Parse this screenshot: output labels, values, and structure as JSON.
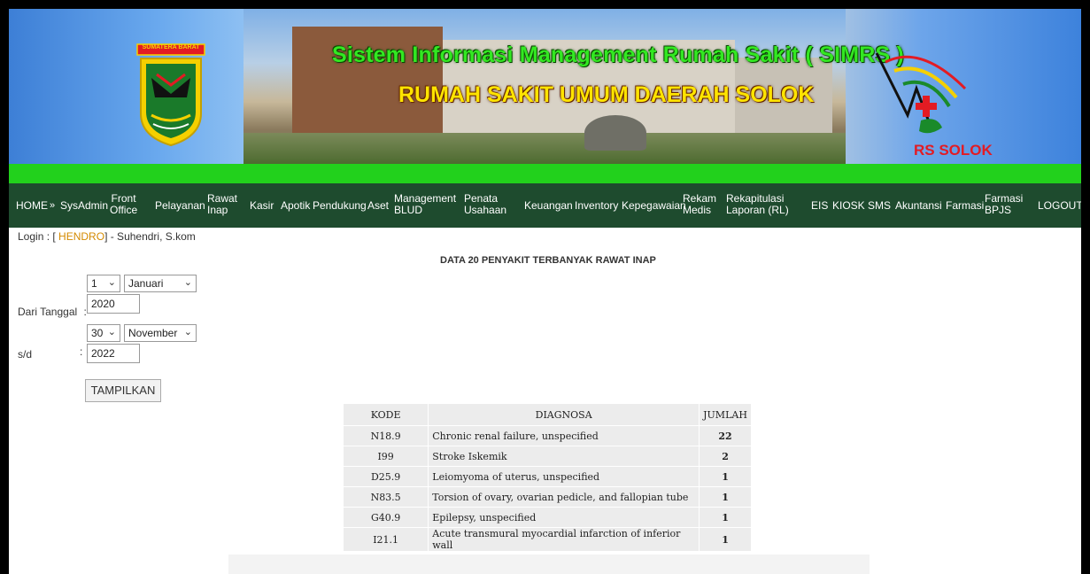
{
  "banner": {
    "logo_text": "SUMATERA BARAT",
    "title_line1": "Sistem Informasi Management Rumah Sakit ( SIMRS )",
    "title_line2": "RUMAH SAKIT UMUM DAERAH SOLOK",
    "rs_logo_text": "RS SOLOK"
  },
  "nav": {
    "home": "HOME",
    "sep": "»",
    "sysadmin": "SysAdmin",
    "front_office": [
      "Front",
      "Office"
    ],
    "pelayanan": "Pelayanan",
    "rawat_inap": [
      "Rawat",
      "Inap"
    ],
    "kasir": "Kasir",
    "apotik": "Apotik",
    "pendukung": "Pendukung",
    "aset": "Aset",
    "management_blud": [
      "Management",
      "BLUD"
    ],
    "penata_usahaan": [
      "Penata",
      "Usahaan"
    ],
    "keuangan": "Keuangan",
    "inventory": "Inventory",
    "kepegawaian": "Kepegawaian",
    "rekam_medis": [
      "Rekam",
      "Medis"
    ],
    "rekapitulasi": [
      "Rekapitulasi",
      "Laporan (RL)"
    ],
    "eis": "EIS",
    "kiosk": "KIOSK",
    "sms": "SMS",
    "akuntansi": "Akuntansi",
    "farmasi": "Farmasi",
    "farmasi_bpjs": [
      "Farmasi",
      "BPJS"
    ],
    "logout": "LOGOUT"
  },
  "login": {
    "prefix": "Login : [",
    "username": "HENDRO",
    "suffix": "] - Suhendri, S.kom"
  },
  "filter": {
    "from_label": "Dari Tanggal",
    "colon": ":",
    "from_day": "1",
    "from_month": "Januari",
    "from_year": "2020",
    "to_label": "s/d",
    "to_day": "30",
    "to_month": "November",
    "to_year": "2022",
    "submit": "TAMPILKAN"
  },
  "report": {
    "heading": "DATA 20 PENYAKIT TERBANYAK RAWAT INAP",
    "columns": [
      "KODE",
      "DIAGNOSA",
      "JUMLAH"
    ],
    "rows": [
      {
        "kode": "N18.9",
        "diagnosa": "Chronic renal failure, unspecified",
        "jumlah": "22"
      },
      {
        "kode": "I99",
        "diagnosa": "Stroke Iskemik",
        "jumlah": "2"
      },
      {
        "kode": "D25.9",
        "diagnosa": "Leiomyoma of uterus, unspecified",
        "jumlah": "1"
      },
      {
        "kode": "N83.5",
        "diagnosa": "Torsion of ovary, ovarian pedicle, and fallopian tube",
        "jumlah": "1"
      },
      {
        "kode": "G40.9",
        "diagnosa": "Epilepsy, unspecified",
        "jumlah": "1"
      },
      {
        "kode": "I21.1",
        "diagnosa": "Acute transmural myocardial infarction of inferior wall",
        "jumlah": "1"
      }
    ]
  },
  "icons": {
    "chevron": "chevron-down-icon"
  }
}
